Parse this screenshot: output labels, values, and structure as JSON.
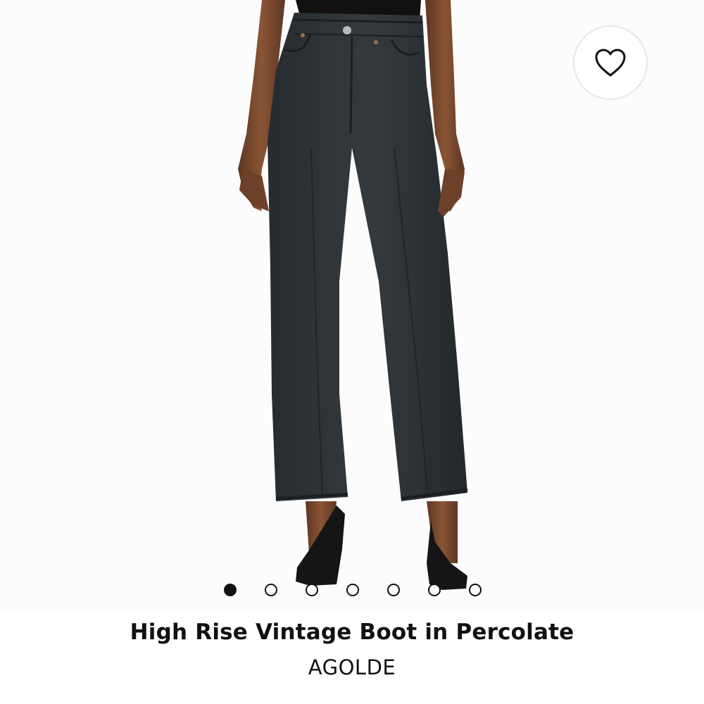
{
  "product": {
    "title": "High Rise Vintage Boot in Percolate",
    "brand": "AGOLDE"
  },
  "image": {
    "description_icon": "product-photo-jeans-icon"
  },
  "wishlist": {
    "icon": "heart-outline-icon"
  },
  "carousel": {
    "total": 7,
    "active_index": 0
  },
  "colors": {
    "denim": "#2b3034",
    "skin": "#7a4a30",
    "shoe": "#151515",
    "text": "#111111"
  }
}
